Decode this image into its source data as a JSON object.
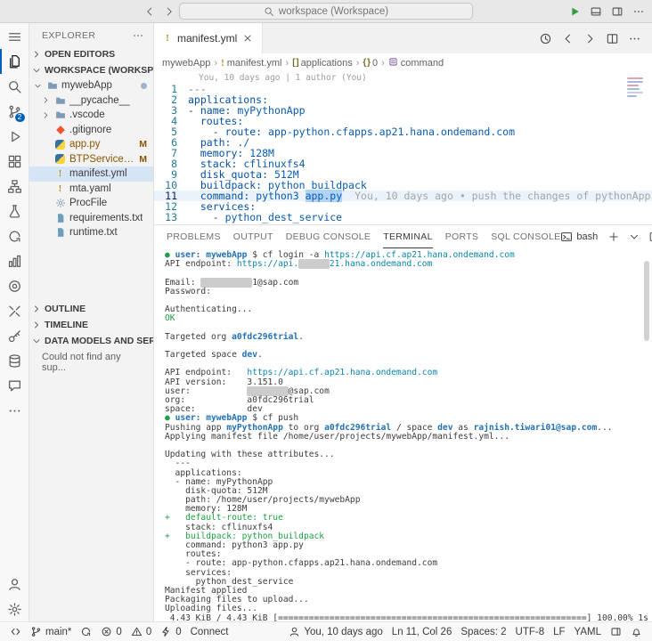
{
  "title_bar": {
    "search_text": "workspace (Workspace)"
  },
  "activity_bar": {
    "top": [
      {
        "name": "menu-icon",
        "icon": "menu"
      },
      {
        "name": "explorer-icon",
        "icon": "files",
        "active": true
      },
      {
        "name": "search-view-icon",
        "icon": "search"
      },
      {
        "name": "source-control-icon",
        "icon": "branch",
        "badge": "2"
      },
      {
        "name": "run-debug-icon",
        "icon": "debug"
      },
      {
        "name": "extensions-icon",
        "icon": "extensions"
      },
      {
        "name": "cf-targets-icon",
        "icon": "org"
      },
      {
        "name": "test-explorer-icon",
        "icon": "flask"
      },
      {
        "name": "refresh-view-icon",
        "icon": "refresh"
      },
      {
        "name": "metrics-view-icon",
        "icon": "columns"
      },
      {
        "name": "target-view-icon",
        "icon": "target"
      },
      {
        "name": "tools-view-icon",
        "icon": "tools"
      },
      {
        "name": "key-vault-icon",
        "icon": "key"
      },
      {
        "name": "database-view-icon",
        "icon": "database"
      },
      {
        "name": "feedback-icon",
        "icon": "chat"
      },
      {
        "name": "additional-views-icon",
        "icon": "more"
      }
    ],
    "bottom": [
      {
        "name": "accounts-icon",
        "icon": "account"
      },
      {
        "name": "settings-gear-icon",
        "icon": "gear"
      }
    ]
  },
  "sidebar": {
    "title": "EXPLORER",
    "sections": {
      "open_editors": "OPEN EDITORS",
      "workspace": "WORKSPACE (WORKSPACE)",
      "outline": "OUTLINE",
      "timeline": "TIMELINE",
      "data_models": "DATA MODELS AND SERVICES",
      "data_models_empty": "Could not find any sup..."
    },
    "tree": [
      {
        "label": "mywebApp",
        "icon": "folder",
        "depth": 0,
        "chevron": "down",
        "dot": true
      },
      {
        "label": "__pycache__",
        "icon": "folder",
        "depth": 1,
        "chevron": "right"
      },
      {
        "label": ".vscode",
        "icon": "folder",
        "depth": 1,
        "chevron": "right"
      },
      {
        "label": ".gitignore",
        "icon": "git",
        "depth": 1
      },
      {
        "label": "app.py",
        "icon": "python",
        "depth": 1,
        "badge": "M",
        "modified": true
      },
      {
        "label": "BTPServices.py",
        "icon": "python",
        "depth": 1,
        "badge": "M",
        "modified": true
      },
      {
        "label": "manifest.yml",
        "icon": "yaml",
        "depth": 1,
        "selected": true
      },
      {
        "label": "mta.yaml",
        "icon": "yaml",
        "depth": 1
      },
      {
        "label": "ProcFile",
        "icon": "gearfile",
        "depth": 1
      },
      {
        "label": "requirements.txt",
        "icon": "doc",
        "depth": 1
      },
      {
        "label": "runtime.txt",
        "icon": "doc",
        "depth": 1
      }
    ]
  },
  "editor": {
    "tab": {
      "label": "manifest.yml"
    },
    "actions": [
      {
        "name": "timeline-button",
        "icon": "history"
      },
      {
        "name": "back-button",
        "icon": "arrow-left"
      },
      {
        "name": "forward-button",
        "icon": "arrow-right"
      },
      {
        "name": "split-editor-button",
        "icon": "split"
      },
      {
        "name": "more-editor-actions-button",
        "icon": "more"
      }
    ],
    "breadcrumbs": [
      {
        "icon": "",
        "label": "mywebApp"
      },
      {
        "icon": "yaml",
        "label": "manifest.yml"
      },
      {
        "icon": "array",
        "label": "applications"
      },
      {
        "icon": "object",
        "label": "0"
      },
      {
        "icon": "symbol",
        "label": "command"
      }
    ],
    "blame_header": "You, 10 days ago | 1 author (You)",
    "inline_blame": "You, 10 days ago • push the changes of pythonApp",
    "cursor": "Ln 11, Col 26",
    "lines": [
      {
        "n": 1,
        "segs": [
          [
            "m",
            "---"
          ]
        ]
      },
      {
        "n": 2,
        "segs": [
          [
            "k",
            "applications:"
          ]
        ]
      },
      {
        "n": 3,
        "segs": [
          [
            "d",
            "- "
          ],
          [
            "k",
            "name:"
          ],
          [
            "t",
            " "
          ],
          [
            "v",
            "myPythonApp"
          ]
        ]
      },
      {
        "n": 4,
        "segs": [
          [
            "t",
            "  "
          ],
          [
            "k",
            "routes:"
          ]
        ]
      },
      {
        "n": 5,
        "segs": [
          [
            "t",
            "    "
          ],
          [
            "d",
            "- "
          ],
          [
            "k",
            "route:"
          ],
          [
            "t",
            " "
          ],
          [
            "v",
            "app-python.cfapps.ap21.hana.ondemand.com"
          ]
        ]
      },
      {
        "n": 6,
        "segs": [
          [
            "t",
            "  "
          ],
          [
            "k",
            "path:"
          ],
          [
            "t",
            " "
          ],
          [
            "v",
            "./"
          ]
        ]
      },
      {
        "n": 7,
        "segs": [
          [
            "t",
            "  "
          ],
          [
            "k",
            "memory:"
          ],
          [
            "t",
            " "
          ],
          [
            "v",
            "128M"
          ]
        ]
      },
      {
        "n": 8,
        "segs": [
          [
            "t",
            "  "
          ],
          [
            "k",
            "stack:"
          ],
          [
            "t",
            " "
          ],
          [
            "v",
            "cflinuxfs4"
          ]
        ]
      },
      {
        "n": 9,
        "segs": [
          [
            "t",
            "  "
          ],
          [
            "k",
            "disk_quota:"
          ],
          [
            "t",
            " "
          ],
          [
            "v",
            "512M"
          ]
        ]
      },
      {
        "n": 10,
        "segs": [
          [
            "t",
            "  "
          ],
          [
            "k",
            "buildpack:"
          ],
          [
            "t",
            " "
          ],
          [
            "v",
            "python_buildpack"
          ]
        ]
      },
      {
        "n": 11,
        "current": true,
        "segs": [
          [
            "t",
            "  "
          ],
          [
            "k",
            "command:"
          ],
          [
            "t",
            " "
          ],
          [
            "v",
            "python3 "
          ],
          [
            "s",
            "app.py"
          ]
        ],
        "blame": "You, 10 days ago • push the changes of pythonApp"
      },
      {
        "n": 12,
        "segs": [
          [
            "t",
            "  "
          ],
          [
            "k",
            "services:"
          ]
        ]
      },
      {
        "n": 13,
        "segs": [
          [
            "t",
            "    "
          ],
          [
            "d",
            "- "
          ],
          [
            "v",
            "python_dest_service"
          ]
        ]
      }
    ]
  },
  "terminal": {
    "tabs": [
      "PROBLEMS",
      "OUTPUT",
      "DEBUG CONSOLE",
      "TERMINAL",
      "PORTS",
      "SQL CONSOLE"
    ],
    "active_tab": "TERMINAL",
    "shell_label": "bash",
    "actions": [
      {
        "name": "new-terminal-button",
        "icon": "plus"
      },
      {
        "name": "terminal-profiles-dropdown",
        "icon": "chevron-down"
      },
      {
        "name": "split-terminal-button",
        "icon": "split"
      },
      {
        "name": "kill-terminal-button",
        "icon": "trash"
      },
      {
        "name": "maximize-panel-button",
        "icon": "chevron-up"
      },
      {
        "name": "more-terminal-actions-button",
        "icon": "more"
      },
      {
        "name": "close-panel-button",
        "icon": "close"
      }
    ],
    "lines": [
      [
        [
          "g",
          "● "
        ],
        [
          "bb",
          "user:"
        ],
        [
          "p",
          " "
        ],
        [
          "bb",
          "mywebApp"
        ],
        [
          "p",
          " $ cf login -a "
        ],
        [
          "u",
          "https://api.cf.ap21.hana.ondemand.com"
        ]
      ],
      [
        [
          "p",
          "API endpoint: "
        ],
        [
          "u",
          "https://api."
        ],
        [
          "x",
          "      "
        ],
        [
          "u",
          "21.hana.ondemand.com"
        ]
      ],
      [],
      [
        [
          "p",
          "Email: "
        ],
        [
          "x",
          "          "
        ],
        [
          "p",
          "1@sap.com"
        ]
      ],
      [
        [
          "p",
          "Password:"
        ]
      ],
      [],
      [
        [
          "p",
          "Authenticating..."
        ]
      ],
      [
        [
          "g",
          "OK"
        ]
      ],
      [],
      [
        [
          "p",
          "Targeted org "
        ],
        [
          "bb",
          "a0fdc296trial"
        ],
        [
          "p",
          "."
        ]
      ],
      [],
      [
        [
          "p",
          "Targeted space "
        ],
        [
          "bb",
          "dev"
        ],
        [
          "p",
          "."
        ]
      ],
      [],
      [
        [
          "p",
          "API endpoint:   "
        ],
        [
          "u",
          "https://api.cf.ap21.hana.ondemand.com"
        ]
      ],
      [
        [
          "p",
          "API version:    3.151.0"
        ]
      ],
      [
        [
          "p",
          "user:           "
        ],
        [
          "x",
          "        "
        ],
        [
          "p",
          "@sap.com"
        ]
      ],
      [
        [
          "p",
          "org:            a0fdc296trial"
        ]
      ],
      [
        [
          "p",
          "space:          dev"
        ]
      ],
      [
        [
          "g",
          "● "
        ],
        [
          "bb",
          "user:"
        ],
        [
          "p",
          " "
        ],
        [
          "bb",
          "mywebApp"
        ],
        [
          "p",
          " $ cf push"
        ]
      ],
      [
        [
          "p",
          "Pushing app "
        ],
        [
          "bb",
          "myPythonApp"
        ],
        [
          "p",
          " to org "
        ],
        [
          "bb",
          "a0fdc296trial"
        ],
        [
          "p",
          " / space "
        ],
        [
          "bb",
          "dev"
        ],
        [
          "p",
          " as "
        ],
        [
          "bb",
          "rajnish.tiwari01@sap.com"
        ],
        [
          "p",
          "..."
        ]
      ],
      [
        [
          "p",
          "Applying manifest file /home/user/projects/mywebApp/manifest.yml..."
        ]
      ],
      [],
      [
        [
          "p",
          "Updating with these attributes..."
        ]
      ],
      [
        [
          "p",
          "  ---"
        ]
      ],
      [
        [
          "p",
          "  applications:"
        ]
      ],
      [
        [
          "p",
          "  - name: myPythonApp"
        ]
      ],
      [
        [
          "p",
          "    disk-quota: 512M"
        ]
      ],
      [
        [
          "p",
          "    path: /home/user/projects/mywebApp"
        ]
      ],
      [
        [
          "p",
          "    memory: 128M"
        ]
      ],
      [
        [
          "g",
          "+   default-route: true"
        ]
      ],
      [
        [
          "p",
          "    stack: cflinuxfs4"
        ]
      ],
      [
        [
          "g",
          "+   buildpack: python_buildpack"
        ]
      ],
      [
        [
          "p",
          "    command: python3 app.py"
        ]
      ],
      [
        [
          "p",
          "    routes:"
        ]
      ],
      [
        [
          "p",
          "    - route: app-python.cfapps.ap21.hana.ondemand.com"
        ]
      ],
      [
        [
          "p",
          "    services:"
        ]
      ],
      [
        [
          "p",
          "      python_dest_service"
        ]
      ],
      [
        [
          "p",
          "Manifest applied"
        ]
      ],
      [
        [
          "p",
          "Packaging files to upload..."
        ]
      ],
      [
        [
          "p",
          "Uploading files..."
        ]
      ],
      [
        [
          "p",
          " 4.43 KiB / 4.43 KiB [============================================================] 100.00% 1s"
        ]
      ]
    ]
  },
  "status_bar": {
    "left": [
      {
        "name": "remote-indicator",
        "icon": "remote",
        "label": ""
      },
      {
        "name": "branch-item",
        "icon": "branch",
        "label": "main*"
      },
      {
        "name": "sync-item",
        "icon": "refresh",
        "label": ""
      },
      {
        "name": "errors-item",
        "icon": "error",
        "label": "0"
      },
      {
        "name": "warnings-item",
        "icon": "warning",
        "label": "0"
      },
      {
        "name": "ports-item",
        "icon": "zap",
        "label": "0"
      },
      {
        "name": "connect-item",
        "icon": "",
        "label": "Connect"
      }
    ],
    "right": [
      {
        "name": "source-control-blame-item",
        "icon": "account",
        "label": "You, 10 days ago"
      },
      {
        "name": "cursor-position-item",
        "icon": "",
        "label": "Ln 11, Col 26"
      },
      {
        "name": "indentation-item",
        "icon": "",
        "label": "Spaces: 2"
      },
      {
        "name": "encoding-item",
        "icon": "",
        "label": "UTF-8"
      },
      {
        "name": "eol-item",
        "icon": "",
        "label": "LF"
      },
      {
        "name": "language-mode-item",
        "icon": "",
        "label": "YAML"
      },
      {
        "name": "layout-item",
        "icon": "layout",
        "label": ""
      },
      {
        "name": "notifications-item",
        "icon": "bell",
        "label": ""
      }
    ]
  }
}
